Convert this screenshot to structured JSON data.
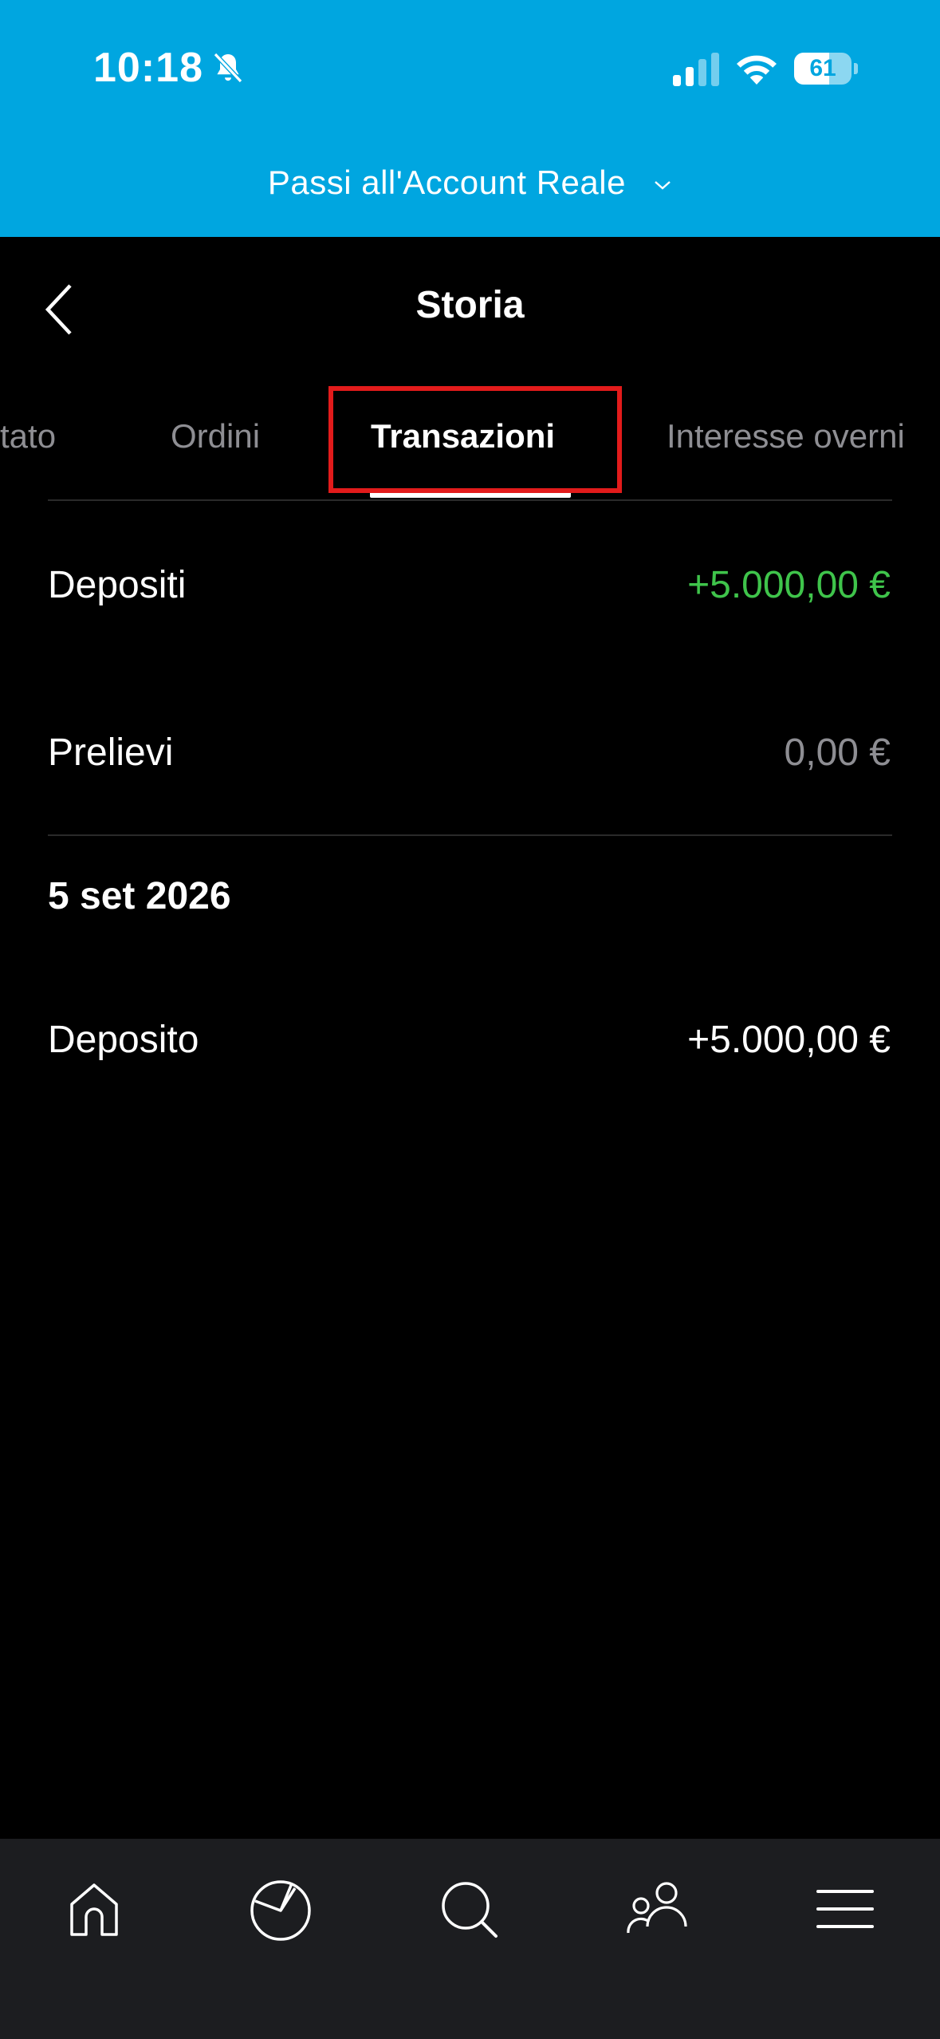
{
  "status_bar": {
    "time": "10:18",
    "battery": "61",
    "battery_level": 0.61,
    "icons": [
      "bell-slash-icon",
      "cellular-signal-icon",
      "wifi-icon",
      "battery-icon"
    ]
  },
  "account_switch": {
    "label": "Passi all'Account Reale",
    "icon": "chevron-down-icon"
  },
  "header": {
    "title": "Storia",
    "back_icon": "chevron-left-icon"
  },
  "tabs": [
    {
      "label": "tato"
    },
    {
      "label": "Ordini"
    },
    {
      "label": "Transazioni",
      "active": true
    },
    {
      "label": "Interesse overni"
    }
  ],
  "summary": {
    "deposits_label": "Depositi",
    "deposits_value": "+5.000,00 €",
    "withdrawals_label": "Prelievi",
    "withdrawals_value": "0,00 €"
  },
  "transactions": {
    "date": "5 set 2026",
    "items": [
      {
        "label": "Deposito",
        "amount": "+5.000,00 €"
      }
    ]
  },
  "bottom_nav": [
    "home-icon",
    "portfolio-pie-icon",
    "search-icon",
    "community-icon",
    "menu-icon"
  ],
  "colors": {
    "banner": "#00a6e0",
    "background": "#000000",
    "positive": "#3fc44b",
    "muted": "#8e8e93",
    "highlight": "#e21b1b",
    "nav_bg": "#1c1d20"
  }
}
